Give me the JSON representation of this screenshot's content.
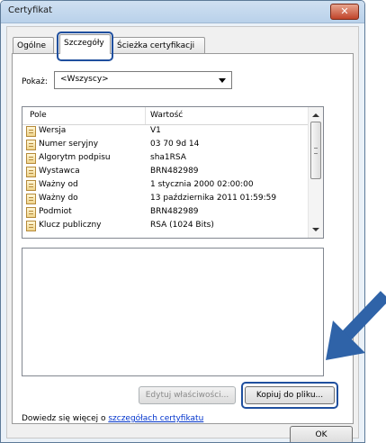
{
  "window": {
    "title": "Certyfikat",
    "close_glyph": "✕"
  },
  "tabs": [
    {
      "label": "Ogólne"
    },
    {
      "label": "Szczegóły"
    },
    {
      "label": "Ścieżka certyfikacji"
    }
  ],
  "show": {
    "label": "Pokaż:",
    "selected": "<Wszyscy>"
  },
  "list": {
    "headers": {
      "field": "Pole",
      "value": "Wartość"
    },
    "rows": [
      {
        "field": "Wersja",
        "value": "V1"
      },
      {
        "field": "Numer seryjny",
        "value": "03 70 9d 14"
      },
      {
        "field": "Algorytm podpisu",
        "value": "sha1RSA"
      },
      {
        "field": "Wystawca",
        "value": "BRN482989"
      },
      {
        "field": "Ważny od",
        "value": "1 stycznia 2000 02:00:00"
      },
      {
        "field": "Ważny do",
        "value": "13 października 2011 01:59:59"
      },
      {
        "field": "Podmiot",
        "value": "BRN482989"
      },
      {
        "field": "Klucz publiczny",
        "value": "RSA (1024 Bits)"
      }
    ]
  },
  "buttons": {
    "edit_properties": "Edytuj właściwości...",
    "copy_to_file": "Kopiuj do pliku...",
    "ok": "OK"
  },
  "learn": {
    "prefix": "Dowiedz się więcej o ",
    "link": "szczegółach certyfikatu"
  },
  "colors": {
    "highlight": "#1f4f9e",
    "arrow": "#2f63a8"
  }
}
